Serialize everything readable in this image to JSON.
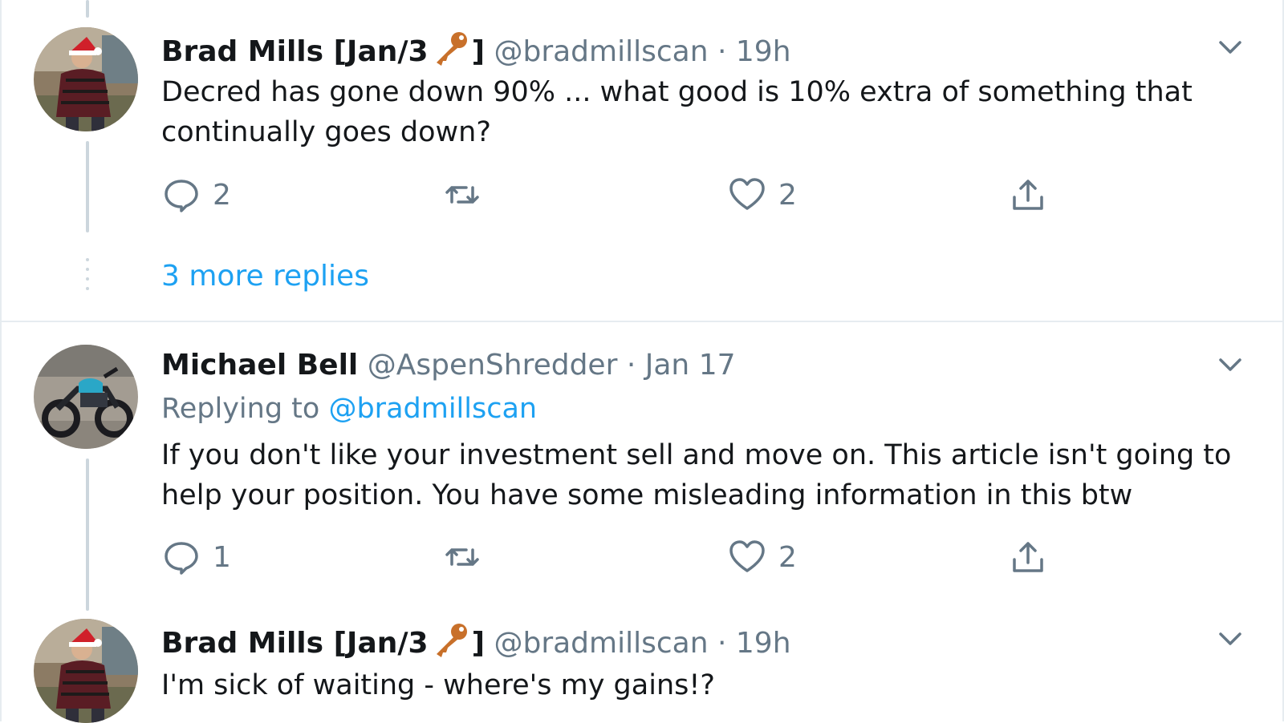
{
  "tweets": [
    {
      "name": "Brad Mills [Jan/3",
      "name_suffix": "]",
      "handle": "@bradmillscan",
      "sep": "·",
      "time": "19h",
      "text": "Decred has gone down 90% ... what good is 10% extra of something that continually goes down?",
      "reply_count": "2",
      "like_count": "2"
    },
    {
      "name": "Michael Bell",
      "handle": "@AspenShredder",
      "sep": "·",
      "time": "Jan 17",
      "replying_label": "Replying to",
      "replying_handle": "@bradmillscan",
      "text": "If you don't like your investment sell and move on. This article isn't going to help your position. You have some misleading information in this btw",
      "reply_count": "1",
      "like_count": "2"
    },
    {
      "name": "Brad Mills [Jan/3",
      "name_suffix": "]",
      "handle": "@bradmillscan",
      "sep": "·",
      "time": "19h",
      "text": "I'm sick of waiting - where's my gains!?"
    }
  ],
  "more_replies": "3 more replies",
  "icons": {
    "reply": "reply-icon",
    "retweet": "retweet-icon",
    "like": "heart-icon",
    "share": "share-icon",
    "caret": "chevron-down-icon",
    "key": "key-emoji-icon"
  },
  "colors": {
    "link": "#1da1f2",
    "muted": "#657786",
    "text": "#14171a",
    "border": "#e6ecf0",
    "key": "#c8702a"
  }
}
